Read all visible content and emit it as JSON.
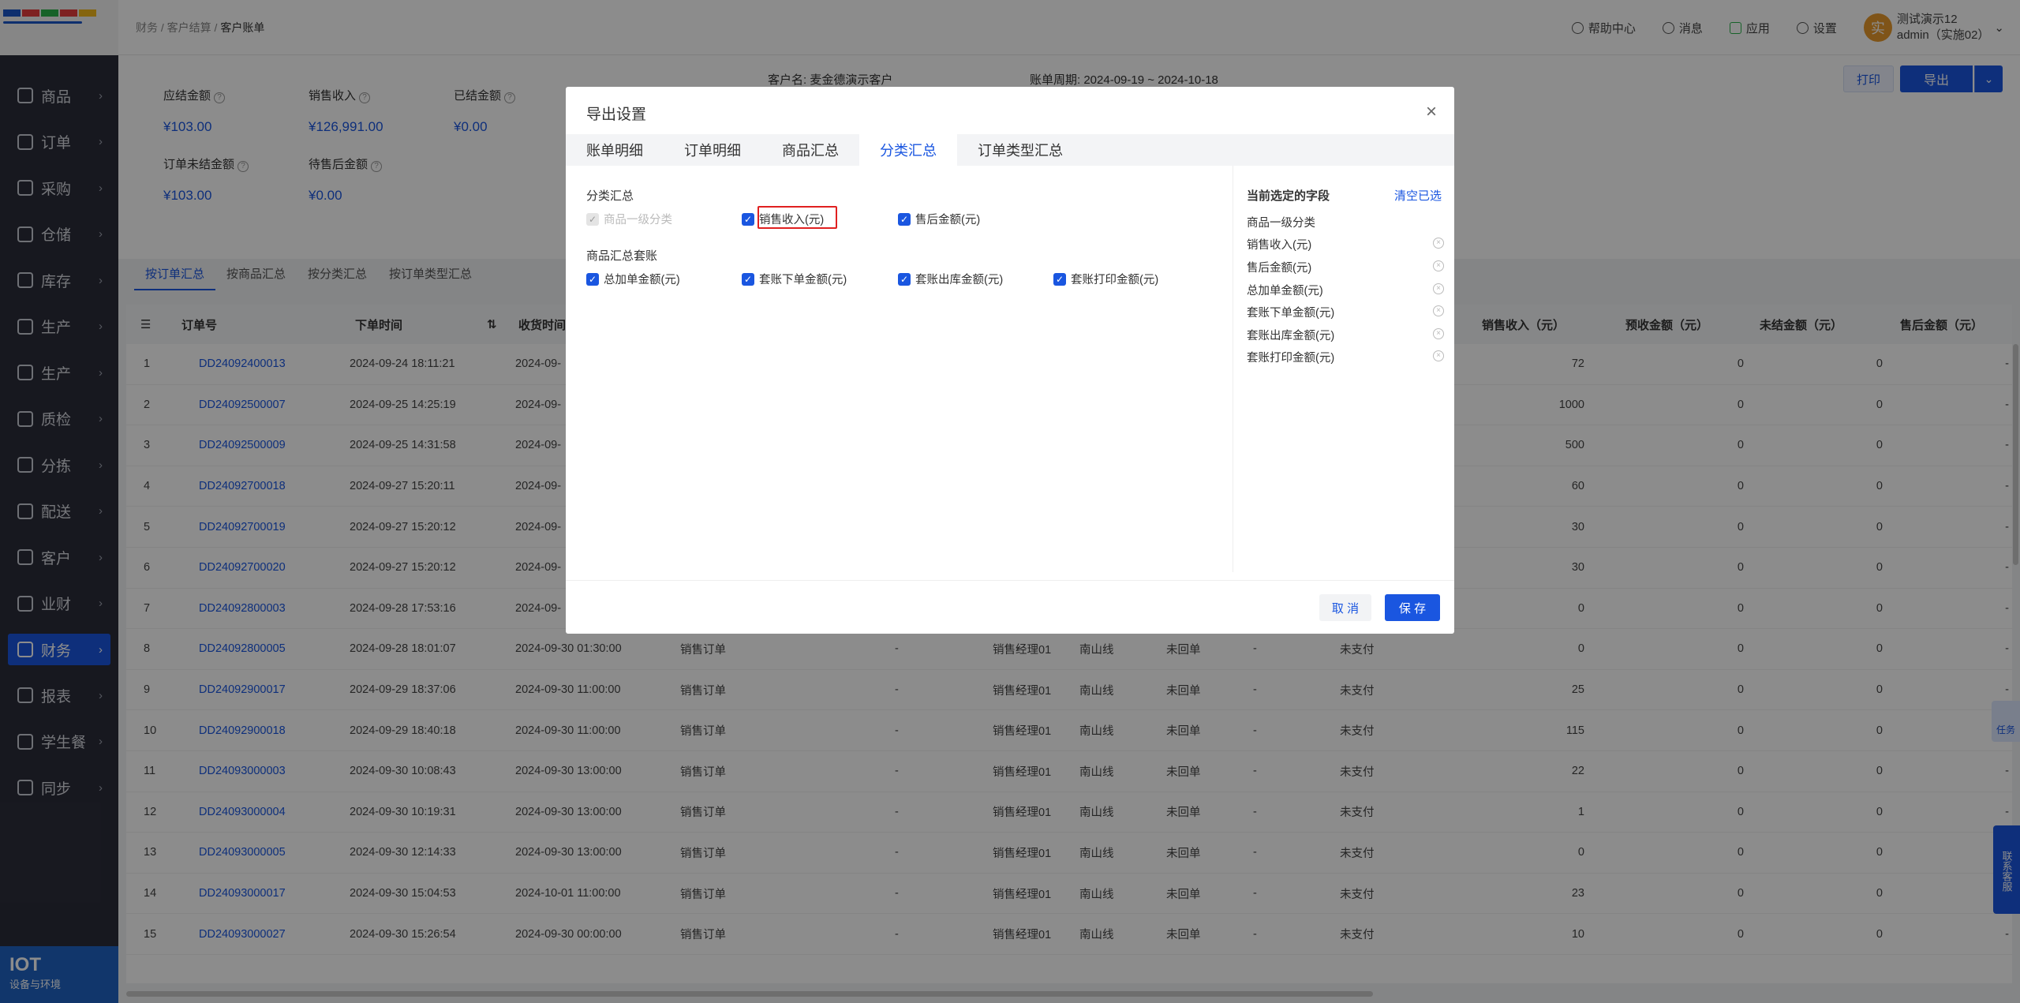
{
  "breadcrumb": [
    "财务",
    "客户结算",
    "客户账单"
  ],
  "header": {
    "help": "帮助中心",
    "messages": "消息",
    "apps": "应用",
    "settings": "设置",
    "avatar_char": "实",
    "user_name": "测试演示12",
    "user_account": "admin（实施02）"
  },
  "sidebar": {
    "items": [
      {
        "label": "商品"
      },
      {
        "label": "订单"
      },
      {
        "label": "采购"
      },
      {
        "label": "仓储"
      },
      {
        "label": "库存"
      },
      {
        "label": "生产"
      },
      {
        "label": "生产"
      },
      {
        "label": "质检"
      },
      {
        "label": "分拣"
      },
      {
        "label": "配送"
      },
      {
        "label": "客户"
      },
      {
        "label": "业财"
      },
      {
        "label": "财务"
      },
      {
        "label": "报表"
      },
      {
        "label": "学生餐"
      },
      {
        "label": "同步"
      }
    ],
    "active_index": 12,
    "footer_title": "IOT",
    "footer_sub": "设备与环境"
  },
  "summary": {
    "stats": [
      {
        "label": "应结金额",
        "value": "¥103.00"
      },
      {
        "label": "销售收入",
        "value": "¥126,991.00"
      },
      {
        "label": "已结金额",
        "value": "¥0.00"
      },
      {
        "label": "订单未结金额",
        "value": "¥103.00"
      },
      {
        "label": "待售后金额",
        "value": "¥0.00"
      }
    ],
    "customer": "客户名:  麦金德演示客户",
    "period": "账单周期:  2024-09-19 ~ 2024-10-18",
    "print": "打印",
    "export": "导出"
  },
  "subtabs": [
    "按订单汇总",
    "按商品汇总",
    "按分类汇总",
    "按订单类型汇总"
  ],
  "table": {
    "headers": {
      "no": "订单号",
      "order_time": "下单时间",
      "recv_time": "收货时间",
      "sales": "销售收入（元）",
      "prepaid": "预收金额（元）",
      "unsettled": "未结金额（元）",
      "aftersale": "售后金额（元）"
    },
    "rows": [
      {
        "idx": "1",
        "id": "DD24092400013",
        "t1": "2024-09-24 18:11:21",
        "t2": "2024-09-",
        "type": "",
        "mgr": "",
        "line": "",
        "back": "",
        "pay": "",
        "sales": "72",
        "pre": "0",
        "un": "0",
        "af": "-"
      },
      {
        "idx": "2",
        "id": "DD24092500007",
        "t1": "2024-09-25 14:25:19",
        "t2": "2024-09-",
        "type": "",
        "mgr": "",
        "line": "",
        "back": "",
        "pay": "",
        "sales": "1000",
        "pre": "0",
        "un": "0",
        "af": "-"
      },
      {
        "idx": "3",
        "id": "DD24092500009",
        "t1": "2024-09-25 14:31:58",
        "t2": "2024-09-",
        "type": "",
        "mgr": "",
        "line": "",
        "back": "",
        "pay": "",
        "sales": "500",
        "pre": "0",
        "un": "0",
        "af": "-"
      },
      {
        "idx": "4",
        "id": "DD24092700018",
        "t1": "2024-09-27 15:20:11",
        "t2": "2024-09-",
        "type": "",
        "mgr": "",
        "line": "",
        "back": "",
        "pay": "",
        "sales": "60",
        "pre": "0",
        "un": "0",
        "af": "-"
      },
      {
        "idx": "5",
        "id": "DD24092700019",
        "t1": "2024-09-27 15:20:12",
        "t2": "2024-09-",
        "type": "",
        "mgr": "",
        "line": "",
        "back": "",
        "pay": "",
        "sales": "30",
        "pre": "0",
        "un": "0",
        "af": "-"
      },
      {
        "idx": "6",
        "id": "DD24092700020",
        "t1": "2024-09-27 15:20:12",
        "t2": "2024-09-",
        "type": "",
        "mgr": "",
        "line": "",
        "back": "",
        "pay": "",
        "sales": "30",
        "pre": "0",
        "un": "0",
        "af": "-"
      },
      {
        "idx": "7",
        "id": "DD24092800003",
        "t1": "2024-09-28 17:53:16",
        "t2": "2024-09-",
        "type": "",
        "mgr": "",
        "line": "",
        "back": "",
        "pay": "",
        "sales": "0",
        "pre": "0",
        "un": "0",
        "af": "-"
      },
      {
        "idx": "8",
        "id": "DD24092800005",
        "t1": "2024-09-28 18:01:07",
        "t2": "2024-09-30 01:30:00",
        "type": "销售订单",
        "mgr": "销售经理01",
        "line": "南山线",
        "back": "未回单",
        "pay": "未支付",
        "sales": "0",
        "pre": "0",
        "un": "0",
        "af": "-"
      },
      {
        "idx": "9",
        "id": "DD24092900017",
        "t1": "2024-09-29 18:37:06",
        "t2": "2024-09-30 11:00:00",
        "type": "销售订单",
        "mgr": "销售经理01",
        "line": "南山线",
        "back": "未回单",
        "pay": "未支付",
        "sales": "25",
        "pre": "0",
        "un": "0",
        "af": "-"
      },
      {
        "idx": "10",
        "id": "DD24092900018",
        "t1": "2024-09-29 18:40:18",
        "t2": "2024-09-30 11:00:00",
        "type": "销售订单",
        "mgr": "销售经理01",
        "line": "南山线",
        "back": "未回单",
        "pay": "未支付",
        "sales": "115",
        "pre": "0",
        "un": "0",
        "af": "-"
      },
      {
        "idx": "11",
        "id": "DD24093000003",
        "t1": "2024-09-30 10:08:43",
        "t2": "2024-09-30 13:00:00",
        "type": "销售订单",
        "mgr": "销售经理01",
        "line": "南山线",
        "back": "未回单",
        "pay": "未支付",
        "sales": "22",
        "pre": "0",
        "un": "0",
        "af": "-"
      },
      {
        "idx": "12",
        "id": "DD24093000004",
        "t1": "2024-09-30 10:19:31",
        "t2": "2024-09-30 13:00:00",
        "type": "销售订单",
        "mgr": "销售经理01",
        "line": "南山线",
        "back": "未回单",
        "pay": "未支付",
        "sales": "1",
        "pre": "0",
        "un": "0",
        "af": "-"
      },
      {
        "idx": "13",
        "id": "DD24093000005",
        "t1": "2024-09-30 12:14:33",
        "t2": "2024-09-30 13:00:00",
        "type": "销售订单",
        "mgr": "销售经理01",
        "line": "南山线",
        "back": "未回单",
        "pay": "未支付",
        "sales": "0",
        "pre": "0",
        "un": "0",
        "af": "-"
      },
      {
        "idx": "14",
        "id": "DD24093000017",
        "t1": "2024-09-30 15:04:53",
        "t2": "2024-10-01 11:00:00",
        "type": "销售订单",
        "mgr": "销售经理01",
        "line": "南山线",
        "back": "未回单",
        "pay": "未支付",
        "sales": "23",
        "pre": "0",
        "un": "0",
        "af": "-"
      },
      {
        "idx": "15",
        "id": "DD24093000027",
        "t1": "2024-09-30 15:26:54",
        "t2": "2024-09-30 00:00:00",
        "type": "销售订单",
        "mgr": "销售经理01",
        "line": "南山线",
        "back": "未回单",
        "pay": "未支付",
        "sales": "10",
        "pre": "0",
        "un": "0",
        "af": "-"
      }
    ]
  },
  "modal": {
    "title": "导出设置",
    "tabs": [
      "账单明细",
      "订单明细",
      "商品汇总",
      "分类汇总",
      "订单类型汇总"
    ],
    "active_tab": 3,
    "group1_title": "分类汇总",
    "group1": [
      "商品一级分类",
      "销售收入(元)",
      "售后金额(元)"
    ],
    "group2_title": "商品汇总套账",
    "group2": [
      "总加单金额(元)",
      "套账下单金额(元)",
      "套账出库金额(元)",
      "套账打印金额(元)"
    ],
    "selected_title": "当前选定的字段",
    "clear_all": "清空已选",
    "selected": [
      "商品一级分类",
      "销售收入(元)",
      "售后金额(元)",
      "总加单金额(元)",
      "套账下单金额(元)",
      "套账出库金额(元)",
      "套账打印金额(元)"
    ],
    "cancel": "取 消",
    "save": "保 存"
  },
  "floats": {
    "task": "任务",
    "service": "联系客服"
  },
  "colors": {
    "accent": "#1a56e0",
    "sidebar": "#2b2d3a",
    "highlight": "#e02020"
  }
}
